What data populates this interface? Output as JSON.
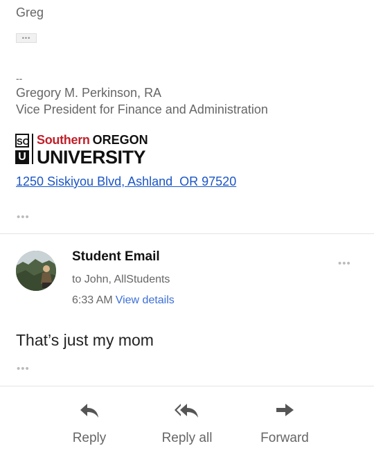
{
  "email": {
    "greeting_sign": "Greg",
    "trimmed_content_glyph": "•••",
    "signature": {
      "dash": "--",
      "name": "Gregory M. Perkinson, RA",
      "title": "Vice President for Finance and Administration",
      "logo": {
        "so": "SO",
        "u": "U",
        "line1_red": "Southern",
        "line1_black": "OREGON",
        "line2": "UNIVERSITY"
      },
      "address": "1250 Siskiyou Blvd, Ashland  OR 97520"
    },
    "more_glyph": "•••"
  },
  "reply_message": {
    "sender": "Student Email",
    "recipients": "to John, AllStudents",
    "time": "6:33 AM",
    "view_details": "View details",
    "body": "That’s just my mom",
    "more_glyph": "•••"
  },
  "actions": {
    "reply": "Reply",
    "reply_all": "Reply all",
    "forward": "Forward"
  },
  "icons": {
    "reply": "reply-icon",
    "reply_all": "reply-all-icon",
    "forward": "forward-icon",
    "more": "more-horizontal-icon"
  },
  "colors": {
    "link": "#1a55c6",
    "view_details": "#3b6fd8",
    "brand_red": "#c0202a",
    "text_gray": "#666666"
  }
}
